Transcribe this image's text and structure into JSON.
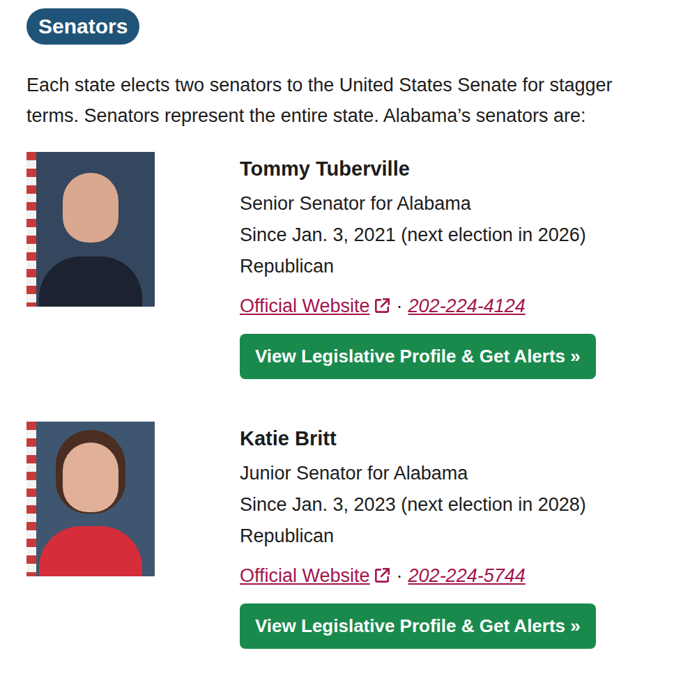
{
  "section": {
    "badge": "Senators"
  },
  "intro": {
    "lines": [
      "Each state elects two senators to the United States Senate for stagger",
      "terms. Senators represent the entire state. Alabama’s senators are:"
    ]
  },
  "senators": [
    {
      "name": "Tommy Tuberville",
      "role": "Senior Senator for Alabama",
      "since": "Since Jan. 3, 2021 (next election in 2026)",
      "party": "Republican",
      "website": "Official Website",
      "separator": "·",
      "phone": "202-224-4124",
      "button": "View Legislative Profile & Get Alerts »"
    },
    {
      "name": "Katie Britt",
      "role": "Junior Senator for Alabama",
      "since": "Since Jan. 3, 2023 (next election in 2028)",
      "party": "Republican",
      "website": "Official Website",
      "separator": "·",
      "phone": "202-224-5744",
      "button": "View Legislative Profile & Get Alerts »"
    }
  ]
}
